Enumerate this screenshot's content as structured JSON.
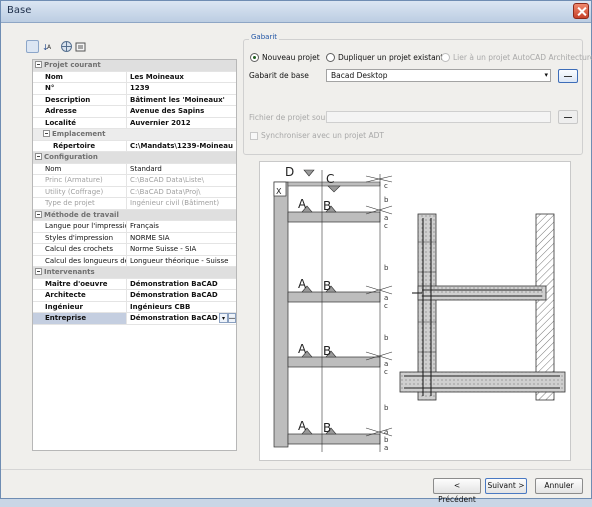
{
  "window": {
    "title": "Base"
  },
  "toolbar": {
    "icons": [
      "categorized-icon",
      "alphabetical-icon",
      "globe-icon",
      "property-pages-icon"
    ]
  },
  "grid": {
    "rows": [
      {
        "kind": "cat",
        "key": "Projet courant"
      },
      {
        "kind": "b",
        "key": "Nom",
        "value": "Les Moineaux"
      },
      {
        "kind": "b",
        "key": "N°",
        "value": "1239"
      },
      {
        "kind": "b",
        "key": "Description",
        "value": "Bâtiment les 'Moineaux'"
      },
      {
        "kind": "b",
        "key": "Adresse",
        "value": "Avenue des Sapins"
      },
      {
        "kind": "b",
        "key": "Localité",
        "value": "Auvernier 2012"
      },
      {
        "kind": "subcat",
        "key": "Emplacement"
      },
      {
        "kind": "b sub",
        "key": "Répertoire",
        "value": "C:\\Mandats\\1239-Moineau"
      },
      {
        "kind": "cat",
        "key": "Configuration"
      },
      {
        "kind": "",
        "key": "Nom",
        "value": "Standard"
      },
      {
        "kind": "g",
        "key": "Princ (Armature)",
        "value": "C:\\BaCAD Data\\Liste\\"
      },
      {
        "kind": "g",
        "key": "Utility (Coffrage)",
        "value": "C:\\BaCAD Data\\Proj\\"
      },
      {
        "kind": "g",
        "key": "Type de projet",
        "value": "Ingénieur civil (Bâtiment)"
      },
      {
        "kind": "cat",
        "key": "Méthode de travail"
      },
      {
        "kind": "",
        "key": "Langue pour l'impression",
        "value": "Français"
      },
      {
        "kind": "",
        "key": "Styles d'impression",
        "value": "NORME SIA"
      },
      {
        "kind": "",
        "key": "Calcul des crochets",
        "value": "Norme Suisse - SIA"
      },
      {
        "kind": "",
        "key": "Calcul des longueurs des barres",
        "value": "Longueur théorique - Suisse"
      },
      {
        "kind": "cat",
        "key": "Intervenants"
      },
      {
        "kind": "b",
        "key": "Maître d'oeuvre",
        "value": "Démonstration BaCAD"
      },
      {
        "kind": "b",
        "key": "Architecte",
        "value": "Démonstration BaCAD"
      },
      {
        "kind": "b",
        "key": "Ingénieur",
        "value": "Ingénieurs CBB"
      },
      {
        "kind": "b sel",
        "key": "Entreprise",
        "value": "Démonstration BaCAD"
      }
    ]
  },
  "gabarit": {
    "legend": "Gabarit",
    "radio_new": "Nouveau projet",
    "radio_dup": "Dupliquer un projet existant",
    "radio_acad": "Lier à un projet AutoCAD Architecture",
    "base_label": "Gabarit de base",
    "base_value": "Bacad Desktop",
    "source_label": "Fichier de projet source",
    "sync_label": "Synchroniser avec un projet ADT"
  },
  "diagram": {
    "labels": [
      "D",
      "C",
      "X",
      "A",
      "B",
      "A",
      "B",
      "A",
      "B",
      "A",
      "B"
    ],
    "dim_letters": [
      "c",
      "b",
      "a",
      "c",
      "b",
      "a",
      "c",
      "b",
      "a",
      "c",
      "b",
      "a",
      "b",
      "a"
    ]
  },
  "buttons": {
    "prev": "< Précédent",
    "next": "Suivant >",
    "cancel": "Annuler"
  }
}
